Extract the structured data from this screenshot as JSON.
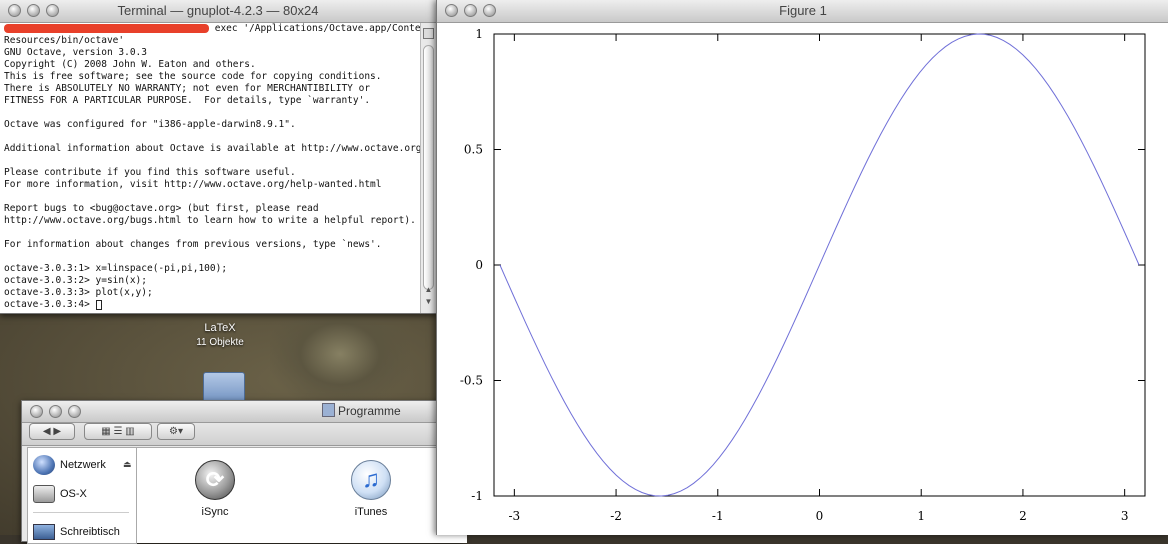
{
  "terminal": {
    "title": "Terminal — gnuplot-4.2.3 — 80x24",
    "first_line_suffix": " exec '/Applications/Octave.app/Contents/",
    "lines": [
      "Resources/bin/octave'",
      "GNU Octave, version 3.0.3",
      "Copyright (C) 2008 John W. Eaton and others.",
      "This is free software; see the source code for copying conditions.",
      "There is ABSOLUTELY NO WARRANTY; not even for MERCHANTIBILITY or",
      "FITNESS FOR A PARTICULAR PURPOSE.  For details, type `warranty'.",
      "",
      "Octave was configured for \"i386-apple-darwin8.9.1\".",
      "",
      "Additional information about Octave is available at http://www.octave.org.",
      "",
      "Please contribute if you find this software useful.",
      "For more information, visit http://www.octave.org/help-wanted.html",
      "",
      "Report bugs to <bug@octave.org> (but first, please read",
      "http://www.octave.org/bugs.html to learn how to write a helpful report).",
      "",
      "For information about changes from previous versions, type `news'.",
      "",
      "octave-3.0.3:1> x=linspace(-pi,pi,100);",
      "octave-3.0.3:2> y=sin(x);",
      "octave-3.0.3:3> plot(x,y);"
    ],
    "prompt": "octave-3.0.3:4> "
  },
  "desktop": {
    "folder_name": "LaTeX",
    "folder_count": "11 Objekte"
  },
  "finder": {
    "title": "Programme",
    "sidebar": [
      {
        "label": "Netzwerk",
        "icon": "network-globe-icon"
      },
      {
        "label": "OS-X",
        "icon": "hard-disk-icon"
      },
      {
        "label": "Schreibtisch",
        "icon": "desktop-icon"
      }
    ],
    "apps": [
      {
        "label": "iSync",
        "icon": "isync-icon"
      },
      {
        "label": "iTunes",
        "icon": "itunes-icon"
      }
    ]
  },
  "figure": {
    "title": "Figure 1"
  },
  "chart_data": {
    "type": "line",
    "title": "",
    "xlabel": "",
    "ylabel": "",
    "xlim": [
      -3.2,
      3.2
    ],
    "ylim": [
      -1,
      1
    ],
    "xticks": [
      -3,
      -2,
      -1,
      0,
      1,
      2,
      3
    ],
    "yticks": [
      -1,
      -0.5,
      0,
      0.5,
      1
    ],
    "xtick_labels": [
      "-3",
      "-2",
      "-1",
      "0",
      "1",
      "2",
      "3"
    ],
    "ytick_labels": [
      "-1",
      "-0.5",
      "0",
      "0.5",
      "1"
    ],
    "series": [
      {
        "function": "sin(x)",
        "x_range": [
          -3.14159,
          3.14159
        ],
        "points": 100,
        "color": "#7070d8"
      }
    ],
    "grid": false,
    "legend": "none"
  }
}
